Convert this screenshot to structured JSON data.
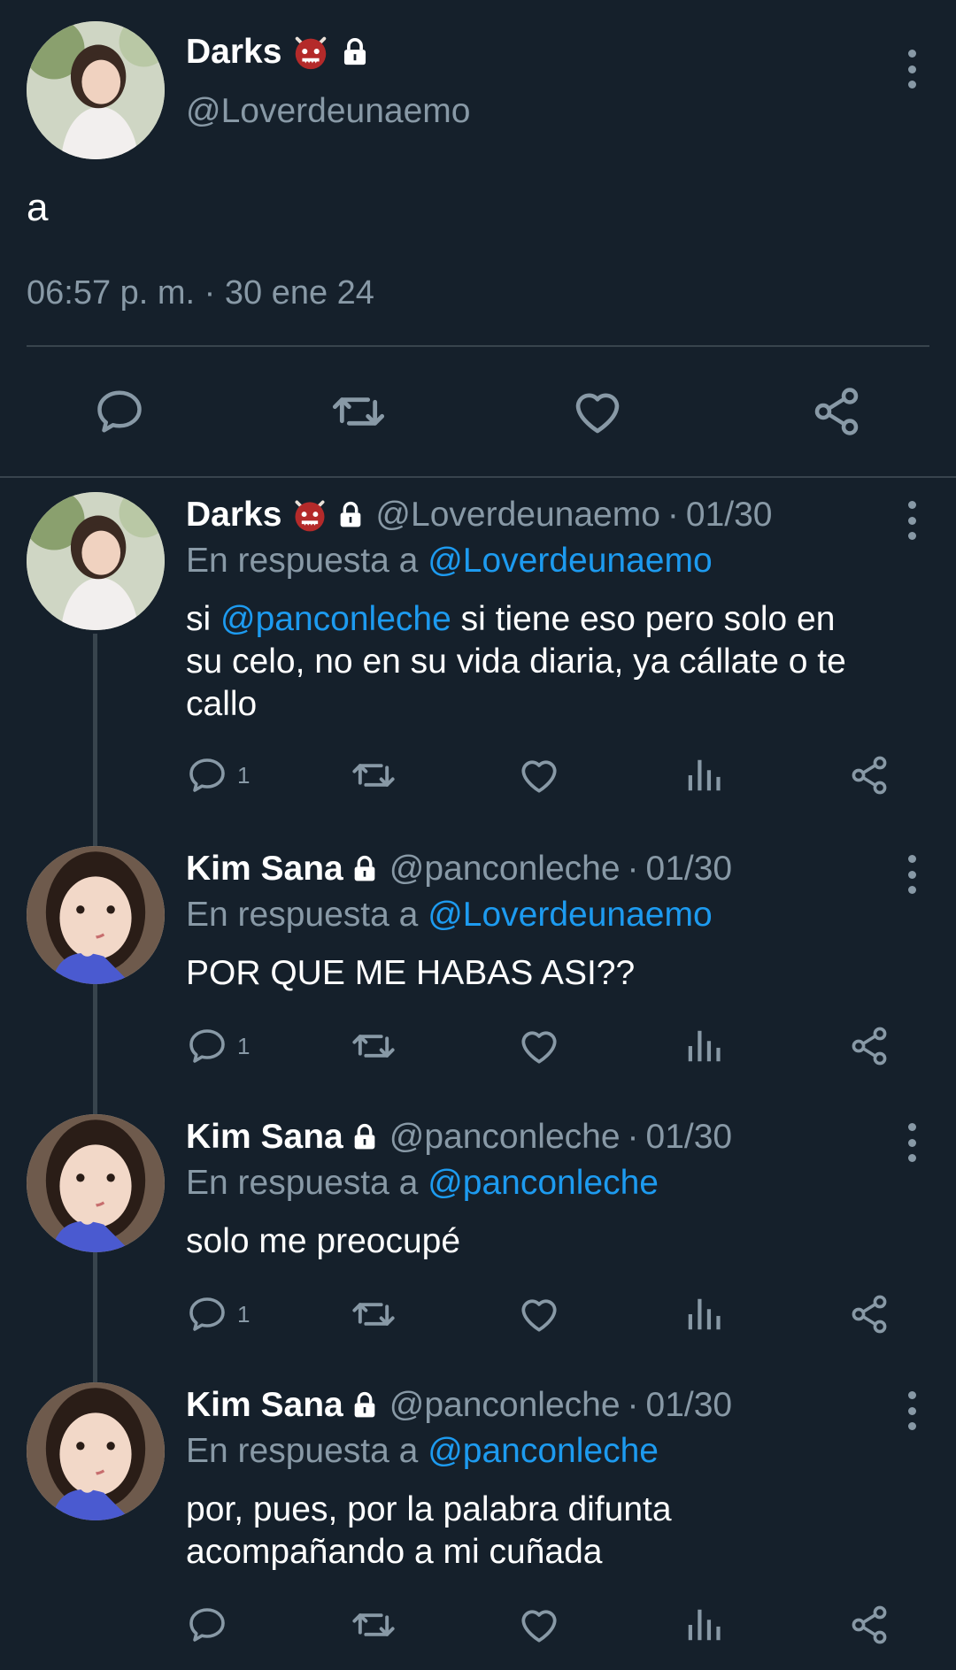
{
  "main": {
    "name": "Darks",
    "handle": "@Loverdeunaemo",
    "text": "a",
    "timestamp": "06:57 p. m. · 30 ene 24",
    "badge_icons": [
      "ogre-emoji-icon",
      "lock-icon"
    ]
  },
  "replies": [
    {
      "name": "Darks",
      "handle": "@Loverdeunaemo",
      "date": "01/30",
      "reply_prefix": "En respuesta a",
      "reply_to": "@Loverdeunaemo",
      "text_line1_pre": "si ",
      "text_mention": "@panconleche",
      "text_line1_post": " si tiene eso pero solo en",
      "text_line2": "su celo, no en su vida diaria, ya cállate o te",
      "text_line3": "callo",
      "reply_count": "1"
    },
    {
      "name": "Kim Sana",
      "handle": "@panconleche",
      "date": "01/30",
      "reply_prefix": "En respuesta a",
      "reply_to": "@Loverdeunaemo",
      "text": "POR QUE ME HABAS ASI??",
      "reply_count": "1"
    },
    {
      "name": "Kim Sana",
      "handle": "@panconleche",
      "date": "01/30",
      "reply_prefix": "En respuesta a",
      "reply_to": "@panconleche",
      "text": "solo me preocupé",
      "reply_count": "1"
    },
    {
      "name": "Kim Sana",
      "handle": "@panconleche",
      "date": "01/30",
      "reply_prefix": "En respuesta a",
      "reply_to": "@panconleche",
      "text_line1": "por, pues, por la palabra difunta",
      "text_line2": "acompañando a mi cuñada"
    }
  ],
  "colors": {
    "background": "#15202b",
    "secondary_text": "#8899a6",
    "link": "#1d9bf0",
    "divider": "#38444d"
  }
}
